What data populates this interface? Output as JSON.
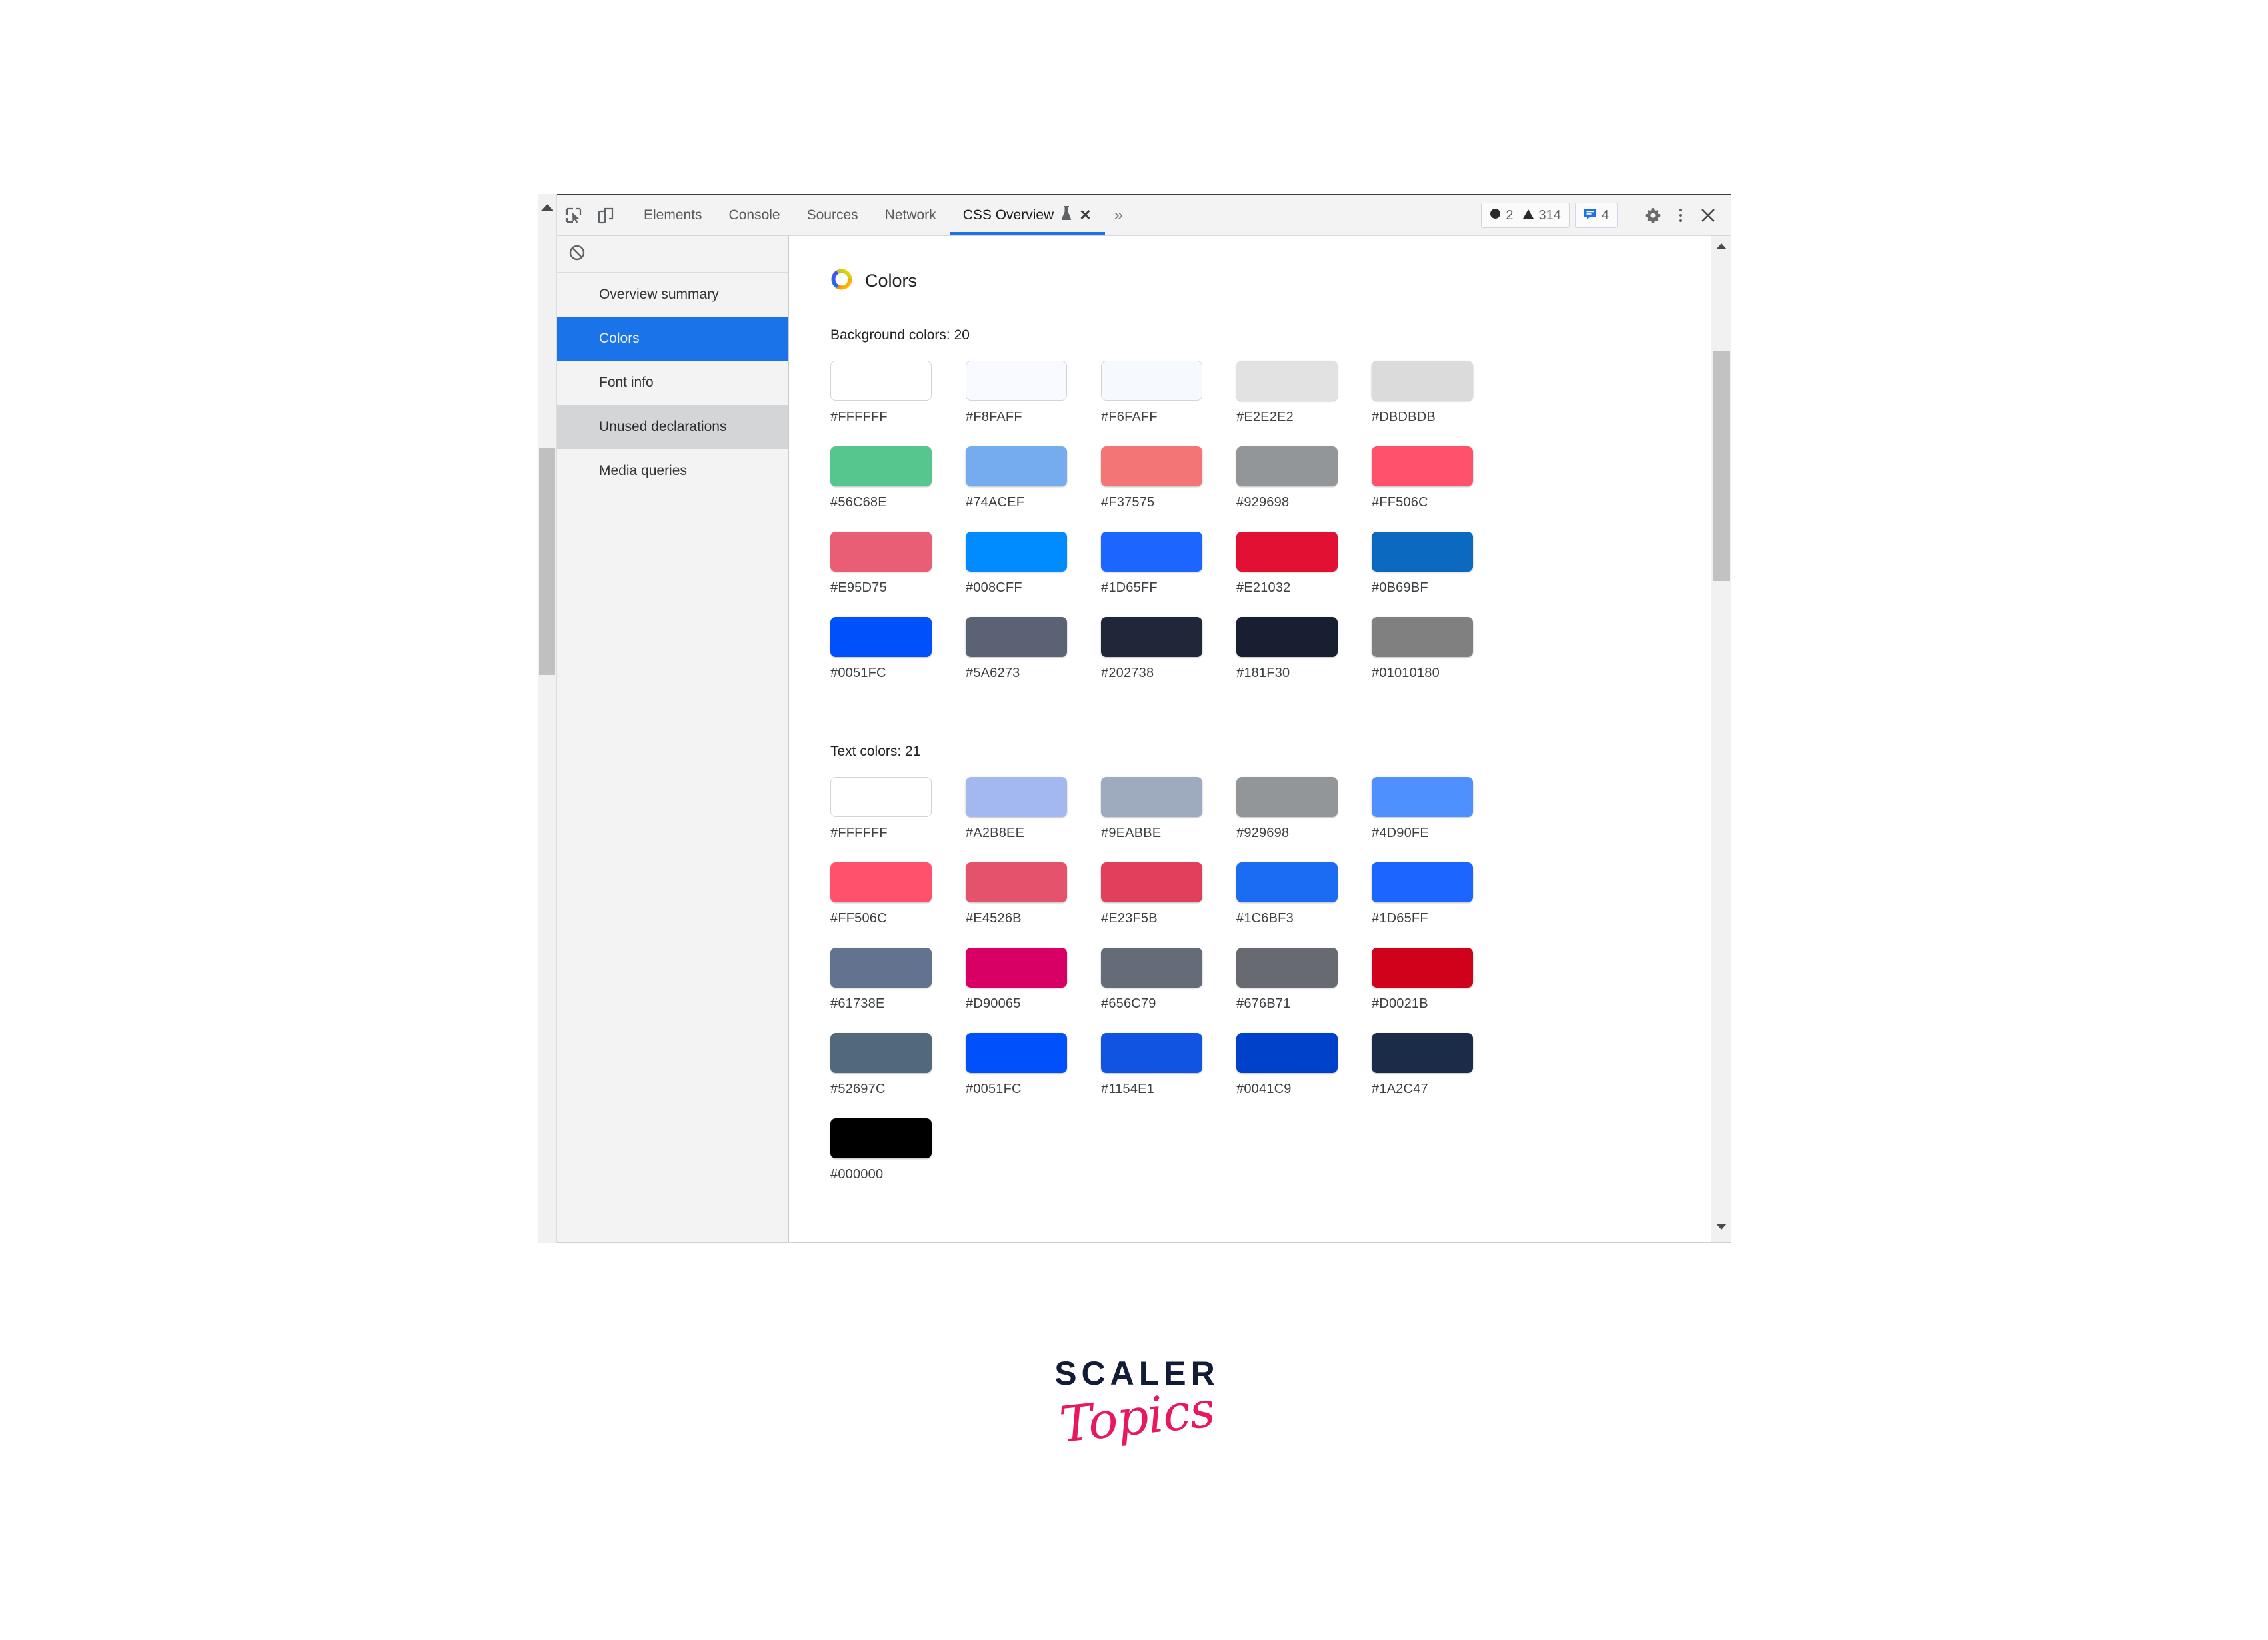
{
  "devtools": {
    "toolbar": {
      "inspect_icon": "inspect-element-icon",
      "device_icon": "device-toolbar-icon",
      "tabs": [
        {
          "label": "Elements",
          "active": false
        },
        {
          "label": "Console",
          "active": false
        },
        {
          "label": "Sources",
          "active": false
        },
        {
          "label": "Network",
          "active": false
        },
        {
          "label": "CSS Overview",
          "active": true,
          "flask_icon": "experiment-flask-icon",
          "close_icon": "close-tab-icon"
        }
      ],
      "overflow_label": "»",
      "counters": {
        "error_icon": "error-circle-icon",
        "error_count": "2",
        "warning_icon": "warning-triangle-icon",
        "warning_count": "314",
        "info_icon": "info-message-icon",
        "info_count": "4"
      },
      "settings_icon": "gear-icon",
      "more_icon": "more-vertical-icon",
      "close_icon": "close-devtools-icon"
    },
    "sidebar": {
      "clear_icon": "clear-overview-icon",
      "items": [
        {
          "label": "Overview summary",
          "state": "normal"
        },
        {
          "label": "Colors",
          "state": "selected"
        },
        {
          "label": "Font info",
          "state": "normal"
        },
        {
          "label": "Unused declarations",
          "state": "hovered"
        },
        {
          "label": "Media queries",
          "state": "normal"
        }
      ]
    },
    "content": {
      "panel_icon": "color-wheel-icon",
      "panel_title": "Colors",
      "sections": [
        {
          "label": "Background colors: 20",
          "swatches": [
            {
              "hex": "#FFFFFF"
            },
            {
              "hex": "#F8FAFF"
            },
            {
              "hex": "#F6FAFF"
            },
            {
              "hex": "#E2E2E2"
            },
            {
              "hex": "#DBDBDB"
            },
            {
              "hex": "#56C68E"
            },
            {
              "hex": "#74ACEF"
            },
            {
              "hex": "#F37575"
            },
            {
              "hex": "#929698"
            },
            {
              "hex": "#FF506C"
            },
            {
              "hex": "#E95D75"
            },
            {
              "hex": "#008CFF"
            },
            {
              "hex": "#1D65FF"
            },
            {
              "hex": "#E21032"
            },
            {
              "hex": "#0B69BF"
            },
            {
              "hex": "#0051FC"
            },
            {
              "hex": "#5A6273"
            },
            {
              "hex": "#202738"
            },
            {
              "hex": "#181F30"
            },
            {
              "hex": "#01010180"
            }
          ]
        },
        {
          "label": "Text colors: 21",
          "swatches": [
            {
              "hex": "#FFFFFF"
            },
            {
              "hex": "#A2B8EE"
            },
            {
              "hex": "#9EABBE"
            },
            {
              "hex": "#929698"
            },
            {
              "hex": "#4D90FE"
            },
            {
              "hex": "#FF506C"
            },
            {
              "hex": "#E4526B"
            },
            {
              "hex": "#E23F5B"
            },
            {
              "hex": "#1C6BF3"
            },
            {
              "hex": "#1D65FF"
            },
            {
              "hex": "#61738E"
            },
            {
              "hex": "#D90065"
            },
            {
              "hex": "#656C79"
            },
            {
              "hex": "#676B71"
            },
            {
              "hex": "#D0021B"
            },
            {
              "hex": "#52697C"
            },
            {
              "hex": "#0051FC"
            },
            {
              "hex": "#1154E1"
            },
            {
              "hex": "#0041C9"
            },
            {
              "hex": "#1A2C47"
            },
            {
              "hex": "#000000"
            }
          ]
        }
      ]
    }
  },
  "branding": {
    "name": "SCALER",
    "sub": "Topics",
    "name_color": "#131C36",
    "sub_color": "#E8185F"
  },
  "accent_color": "#1A73E8"
}
